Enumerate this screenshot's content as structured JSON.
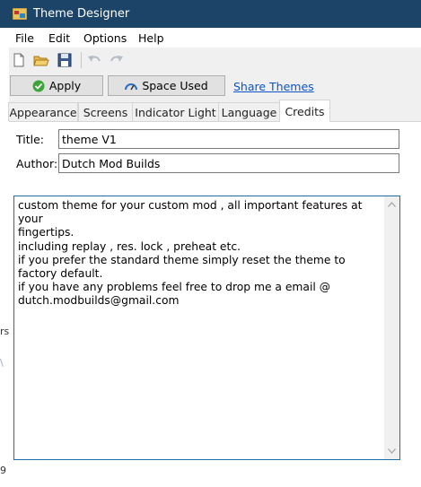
{
  "window": {
    "title": "Theme Designer"
  },
  "menu": [
    "File",
    "Edit",
    "Options",
    "Help"
  ],
  "toolbar": {
    "icons": [
      "new-file-icon",
      "open-folder-icon",
      "save-icon",
      "undo-icon",
      "redo-icon"
    ]
  },
  "actions": {
    "apply_label": "Apply",
    "space_used_label": "Space Used",
    "share_link": "Share Themes"
  },
  "tabs": [
    "Appearance",
    "Screens",
    "Indicator Light",
    "Language",
    "Credits"
  ],
  "active_tab": "Credits",
  "credits": {
    "title_label": "Title:",
    "title_value": "theme V1",
    "author_label": "Author:",
    "author_value": "Dutch Mod Builds",
    "description": "custom theme for your custom mod , all important features at your\nfingertips.\nincluding replay , res. lock , preheat etc.\nif you prefer the standard theme simply reset the theme to factory default.\nif you have any problems feel free to drop me a email @\ndutch.modbuilds@gmail.com"
  },
  "background": {
    "fragments": [
      "rs",
      "\\",
      "9"
    ]
  },
  "colors": {
    "titlebar": "#1b4468",
    "link": "#0a54c6",
    "apply_icon": "#3aa63a",
    "memo_border": "#1a6fa8"
  }
}
